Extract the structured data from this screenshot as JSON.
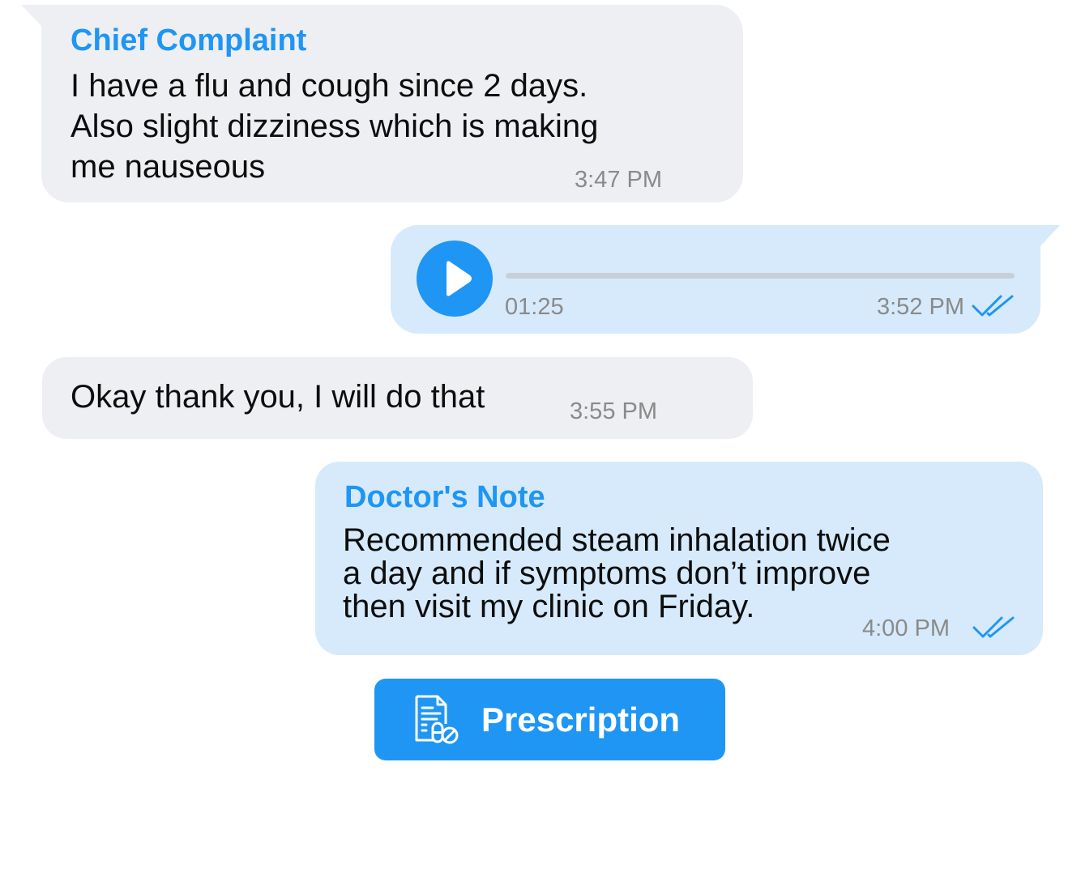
{
  "colors": {
    "accent": "#1f96f3",
    "incoming_bubble": "#eeeff3",
    "outgoing_bubble": "#d6eafc",
    "timestamp": "#8a8a8a"
  },
  "messages": [
    {
      "direction": "incoming",
      "title": "Chief Complaint",
      "text": "I have a flu and cough since 2 days.\nAlso slight dizziness which is making\nme nauseous",
      "time": "3:47 PM"
    },
    {
      "direction": "outgoing",
      "type": "voice",
      "play_icon": "play-icon",
      "duration": "01:25",
      "progress": 0,
      "time": "3:52 PM",
      "status_icon": "double-check-icon"
    },
    {
      "direction": "incoming",
      "text": "Okay thank you, I will do that",
      "time": "3:55 PM"
    },
    {
      "direction": "outgoing",
      "title": "Doctor's Note",
      "text": "Recommended steam inhalation twice\na day and if symptoms don’t improve\nthen visit my clinic on Friday.",
      "time": "4:00 PM",
      "status_icon": "double-check-icon"
    }
  ],
  "prescription_button": {
    "label": "Prescription",
    "icon": "prescription-document-icon"
  }
}
